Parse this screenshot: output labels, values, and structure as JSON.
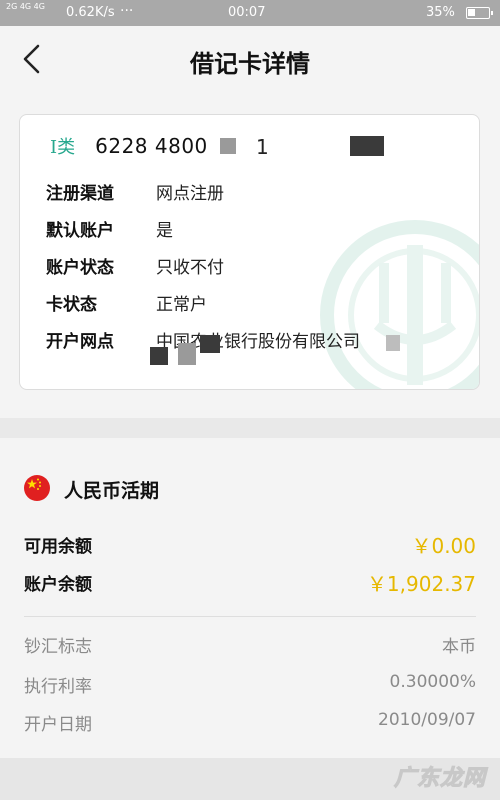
{
  "status_bar": {
    "signal": "2G 4G 4G",
    "speed": "0.62K/s",
    "dots": "···",
    "time": "00:07",
    "battery": "35%"
  },
  "nav": {
    "title": "借记卡详情"
  },
  "card": {
    "type": "I类",
    "number": "6228 4800",
    "number_tail": "1",
    "rows": [
      {
        "label": "注册渠道",
        "value": "网点注册"
      },
      {
        "label": "默认账户",
        "value": "是"
      },
      {
        "label": "账户状态",
        "value": "只收不付"
      },
      {
        "label": "卡状态",
        "value": "正常户"
      },
      {
        "label": "开户网点",
        "value": "中国农业银行股份有限公司"
      }
    ],
    "accent_color": "#27a88e"
  },
  "balance": {
    "currency": "人民币活期",
    "available_label": "可用余额",
    "available_value": "￥0.00",
    "account_label": "账户余额",
    "account_value": "￥1,902.37",
    "amount_color": "#e6b800",
    "meta": [
      {
        "label": "钞汇标志",
        "value": "本币"
      },
      {
        "label": "执行利率",
        "value": "0.30000%"
      },
      {
        "label": "开户日期",
        "value": "2010/09/07"
      }
    ]
  },
  "watermark": "广东龙网"
}
